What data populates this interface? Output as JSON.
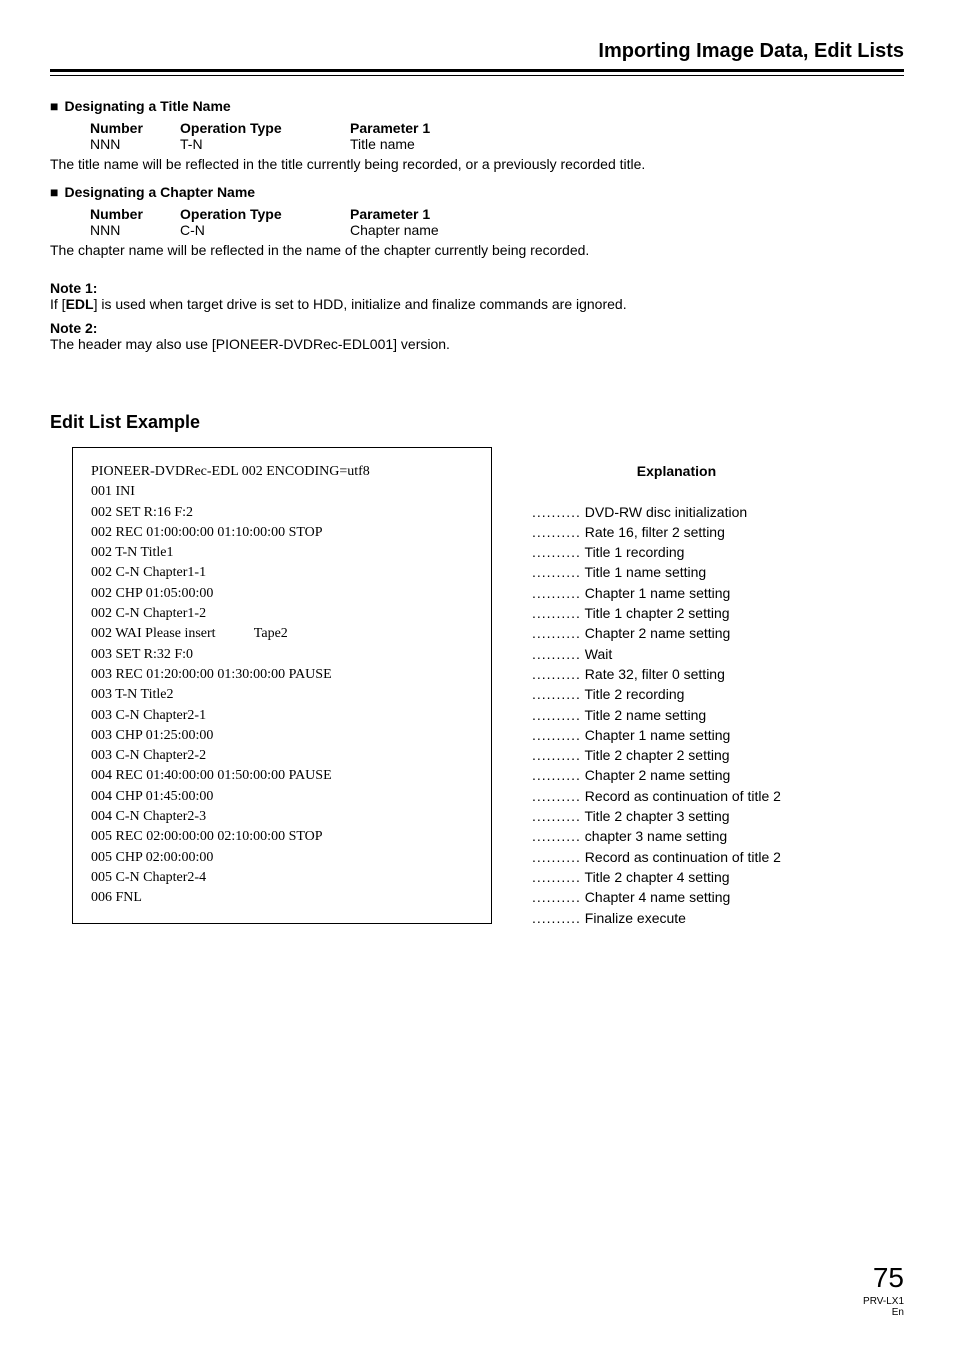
{
  "header": "Importing Image Data, Edit Lists",
  "s1": {
    "heading": "Designating a Title Name",
    "cols": [
      "Number",
      "Operation Type",
      "Parameter 1"
    ],
    "vals": [
      "NNN",
      "T-N",
      "Title name"
    ],
    "desc": "The title name will be reflected in the title currently being recorded, or a previously recorded title."
  },
  "s2": {
    "heading": "Designating a Chapter Name",
    "cols": [
      "Number",
      "Operation Type",
      "Parameter 1"
    ],
    "vals": [
      "NNN",
      "C-N",
      "Chapter name"
    ],
    "desc": "The chapter name will be reflected in the name of the chapter currently being recorded."
  },
  "notes": {
    "n1_label": "Note 1:",
    "n1_pre": "If [",
    "n1_bold": "EDL",
    "n1_post": "] is used when target drive is set to HDD, initialize and finalize commands are ignored.",
    "n2_label": "Note 2:",
    "n2_text": "The header may also use [PIONEER-DVDRec-EDL001] version."
  },
  "example": {
    "heading": "Edit List Example",
    "exp_heading": "Explanation",
    "edl": [
      "PIONEER-DVDRec-EDL 002 ENCODING=utf8",
      "001 INI",
      "002 SET R:16 F:2",
      "002 REC 01:00:00:00 01:10:00:00 STOP",
      "002 T-N Title1",
      "002 C-N Chapter1-1",
      "002 CHP 01:05:00:00",
      "002 C-N Chapter1-2",
      "002 WAI Please insert           Tape2",
      "003 SET R:32 F:0",
      "003 REC 01:20:00:00 01:30:00:00 PAUSE",
      "003 T-N Title2",
      "003 C-N Chapter2-1",
      "003 CHP 01:25:00:00",
      "003 C-N Chapter2-2",
      "004 REC 01:40:00:00 01:50:00:00 PAUSE",
      "004 CHP 01:45:00:00",
      "004 C-N Chapter2-3",
      "005 REC 02:00:00:00 02:10:00:00 STOP",
      "005 CHP 02:00:00:00",
      "005 C-N Chapter2-4",
      "006 FNL"
    ],
    "exp": [
      "",
      "DVD-RW disc initialization",
      "Rate 16, filter 2 setting",
      "Title 1 recording",
      "Title 1 name setting",
      "Chapter 1 name setting",
      "Title 1 chapter 2 setting",
      "Chapter 2 name setting",
      "Wait",
      "Rate 32, filter 0 setting",
      "Title 2 recording",
      "Title 2 name setting",
      "Chapter 1 name setting",
      "Title 2 chapter 2 setting",
      "Chapter 2 name setting",
      "Record as continuation of title 2",
      "Title 2 chapter 3 setting",
      "chapter 3 name setting",
      "Record as continuation of title 2",
      "Title 2 chapter 4 setting",
      "Chapter 4 name setting",
      "Finalize execute"
    ]
  },
  "footer": {
    "page": "75",
    "model": "PRV-LX1",
    "lang": "En"
  }
}
